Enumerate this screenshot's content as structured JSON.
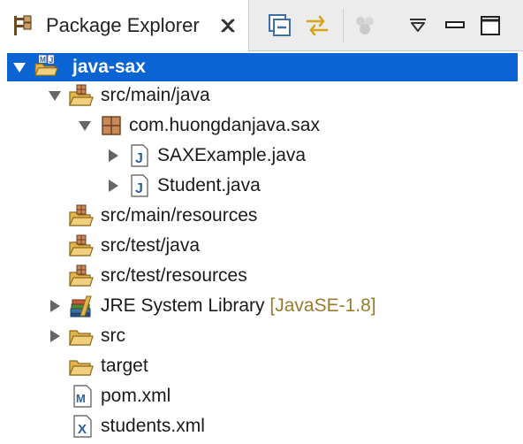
{
  "view": {
    "tab_title": "Package Explorer"
  },
  "toolbar": {
    "collapse_all": "collapse-all-icon",
    "link_editor": "link-with-editor-icon",
    "filters": "filters-icon",
    "view_menu": "view-menu-icon",
    "minimize": "minimize-icon",
    "maximize": "maximize-icon"
  },
  "tree": {
    "project": "java-sax",
    "src_main_java": "src/main/java",
    "package": "com.huongdanjava.sax",
    "file_sax_example": "SAXExample.java",
    "file_student": "Student.java",
    "src_main_resources": "src/main/resources",
    "src_test_java": "src/test/java",
    "src_test_resources": "src/test/resources",
    "jre_library": "JRE System Library",
    "jre_version": "[JavaSE-1.8]",
    "folder_src": "src",
    "folder_target": "target",
    "pom": "pom.xml",
    "students_xml": "students.xml"
  },
  "colors": {
    "selection": "#0b64d4",
    "decoration": "#9a7b2c",
    "folder": "#e3b34c",
    "java_file": "#2f5f9a"
  }
}
